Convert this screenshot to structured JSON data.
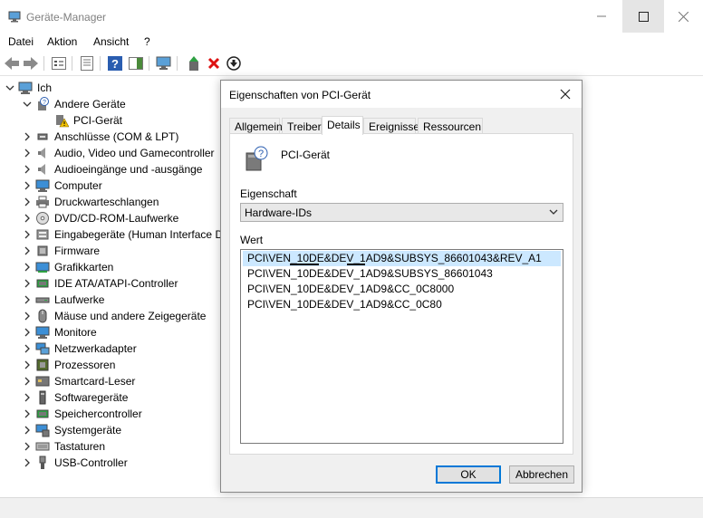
{
  "window": {
    "title": "Geräte-Manager",
    "menu": [
      "Datei",
      "Aktion",
      "Ansicht",
      "?"
    ]
  },
  "tree": {
    "root": "Ich",
    "items": [
      {
        "label": "Andere Geräte",
        "expanded": true,
        "icon": "device-unknown-icon"
      },
      {
        "label": "PCI-Gerät",
        "child": true,
        "icon": "warning-device-icon"
      },
      {
        "label": "Anschlüsse (COM & LPT)",
        "icon": "port-icon"
      },
      {
        "label": "Audio, Video und Gamecontroller",
        "icon": "speaker-icon"
      },
      {
        "label": "Audioeingänge und -ausgänge",
        "icon": "speaker-icon"
      },
      {
        "label": "Computer",
        "icon": "monitor-icon"
      },
      {
        "label": "Druckwarteschlangen",
        "icon": "printer-icon"
      },
      {
        "label": "DVD/CD-ROM-Laufwerke",
        "icon": "disc-icon"
      },
      {
        "label": "Eingabegeräte (Human Interface D",
        "icon": "hid-icon"
      },
      {
        "label": "Firmware",
        "icon": "chip-icon"
      },
      {
        "label": "Grafikkarten",
        "icon": "display-adapter-icon"
      },
      {
        "label": "IDE ATA/ATAPI-Controller",
        "icon": "controller-icon"
      },
      {
        "label": "Laufwerke",
        "icon": "drive-icon"
      },
      {
        "label": "Mäuse und andere Zeigegeräte",
        "icon": "mouse-icon"
      },
      {
        "label": "Monitore",
        "icon": "monitor-icon"
      },
      {
        "label": "Netzwerkadapter",
        "icon": "network-icon"
      },
      {
        "label": "Prozessoren",
        "icon": "cpu-icon"
      },
      {
        "label": "Smartcard-Leser",
        "icon": "smartcard-icon"
      },
      {
        "label": "Softwaregeräte",
        "icon": "software-device-icon"
      },
      {
        "label": "Speichercontroller",
        "icon": "storage-icon"
      },
      {
        "label": "Systemgeräte",
        "icon": "system-icon"
      },
      {
        "label": "Tastaturen",
        "icon": "keyboard-icon"
      },
      {
        "label": "USB-Controller",
        "icon": "usb-icon"
      }
    ]
  },
  "dialog": {
    "title": "Eigenschaften von PCI-Gerät",
    "tabs": [
      "Allgemein",
      "Treiber",
      "Details",
      "Ereignisse",
      "Ressourcen"
    ],
    "active_tab": "Details",
    "device_name": "PCI-Gerät",
    "property_label": "Eigenschaft",
    "property_value": "Hardware-IDs",
    "value_label": "Wert",
    "values": [
      "PCI\\VEN_10DE&DEV_1AD9&SUBSYS_86601043&REV_A1",
      "PCI\\VEN_10DE&DEV_1AD9&SUBSYS_86601043",
      "PCI\\VEN_10DE&DEV_1AD9&CC_0C8000",
      "PCI\\VEN_10DE&DEV_1AD9&CC_0C80"
    ],
    "ok_label": "OK",
    "cancel_label": "Abbrechen"
  },
  "colors": {
    "selection": "#cce8ff",
    "accent": "#0078d7",
    "warning": "#f2c200"
  }
}
